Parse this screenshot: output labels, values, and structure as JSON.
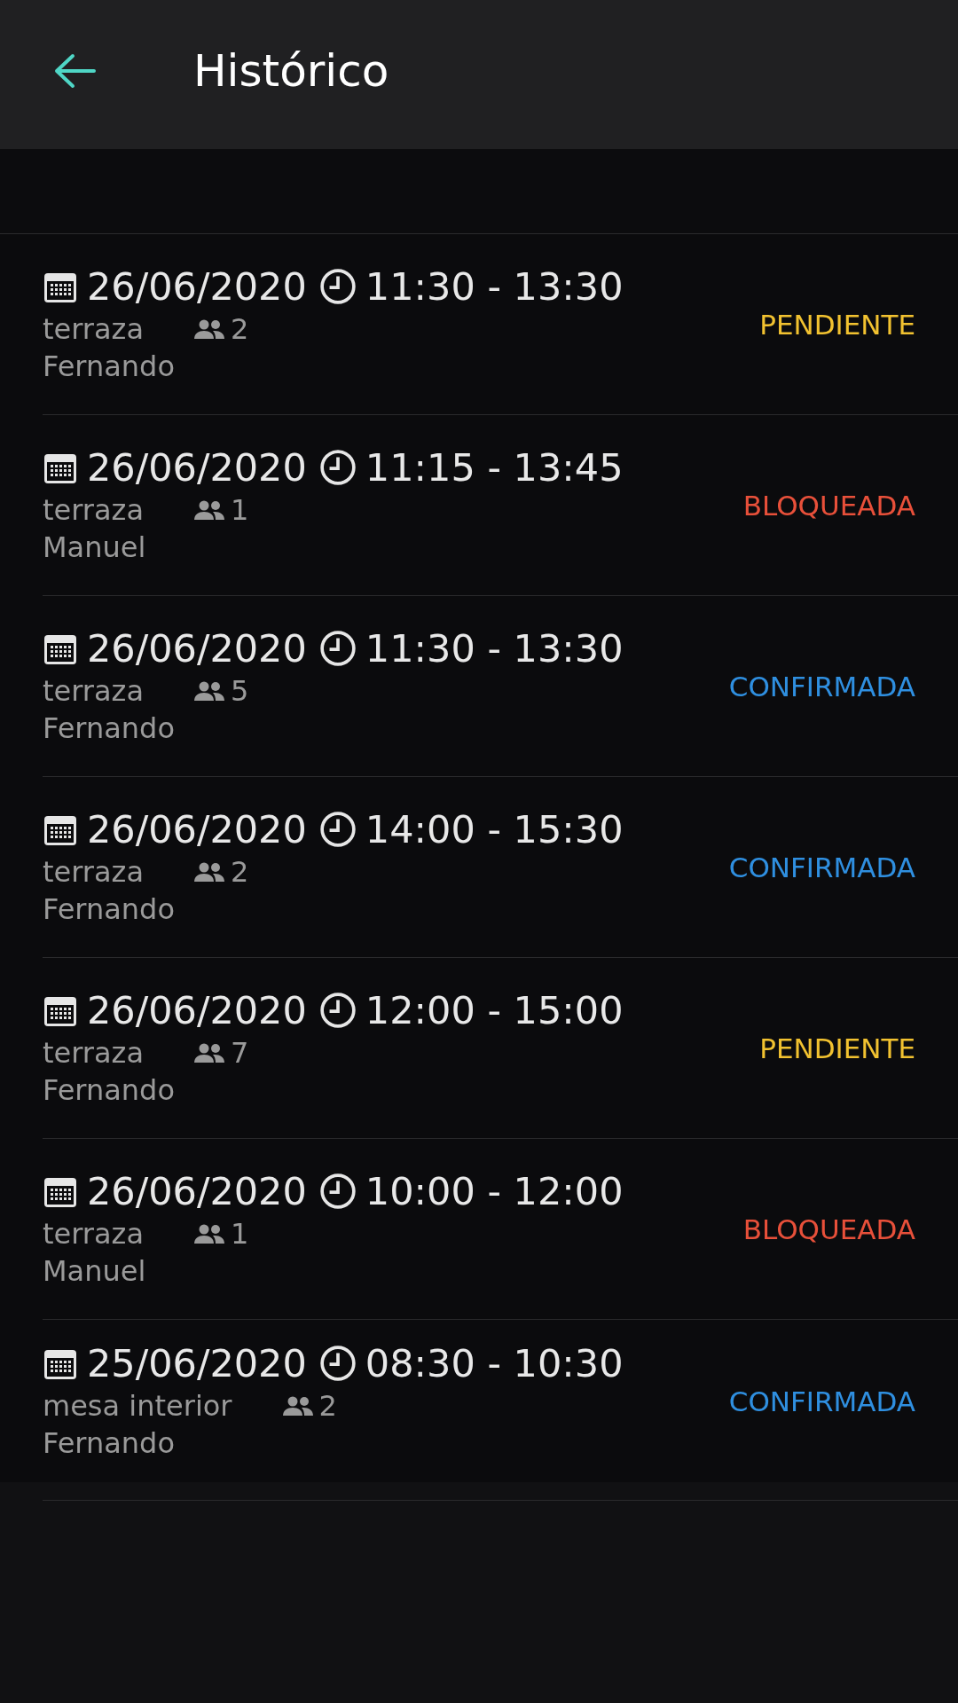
{
  "header": {
    "title": "Histórico"
  },
  "reservations": [
    {
      "date": "26/06/2020",
      "time": "11:30 - 13:30",
      "place": "terraza",
      "guests": "2",
      "name": "Fernando",
      "status": "PENDIENTE",
      "color": "#f2c230"
    },
    {
      "date": "26/06/2020",
      "time": "11:15 - 13:45",
      "place": "terraza",
      "guests": "1",
      "name": "Manuel",
      "status": "BLOQUEADA",
      "color": "#e8503a"
    },
    {
      "date": "26/06/2020",
      "time": "11:30 - 13:30",
      "place": "terraza",
      "guests": "5",
      "name": "Fernando",
      "status": "CONFIRMADA",
      "color": "#2f8fe0"
    },
    {
      "date": "26/06/2020",
      "time": "14:00 - 15:30",
      "place": "terraza",
      "guests": "2",
      "name": "Fernando",
      "status": "CONFIRMADA",
      "color": "#2f8fe0"
    },
    {
      "date": "26/06/2020",
      "time": "12:00 - 15:00",
      "place": "terraza",
      "guests": "7",
      "name": "Fernando",
      "status": "PENDIENTE",
      "color": "#f2c230"
    },
    {
      "date": "26/06/2020",
      "time": "10:00 - 12:00",
      "place": "terraza",
      "guests": "1",
      "name": "Manuel",
      "status": "BLOQUEADA",
      "color": "#e8503a"
    },
    {
      "date": "25/06/2020",
      "time": "08:30 - 10:30",
      "place": "mesa interior",
      "guests": "2",
      "name": "Fernando",
      "status": "CONFIRMADA",
      "color": "#2f8fe0"
    }
  ]
}
